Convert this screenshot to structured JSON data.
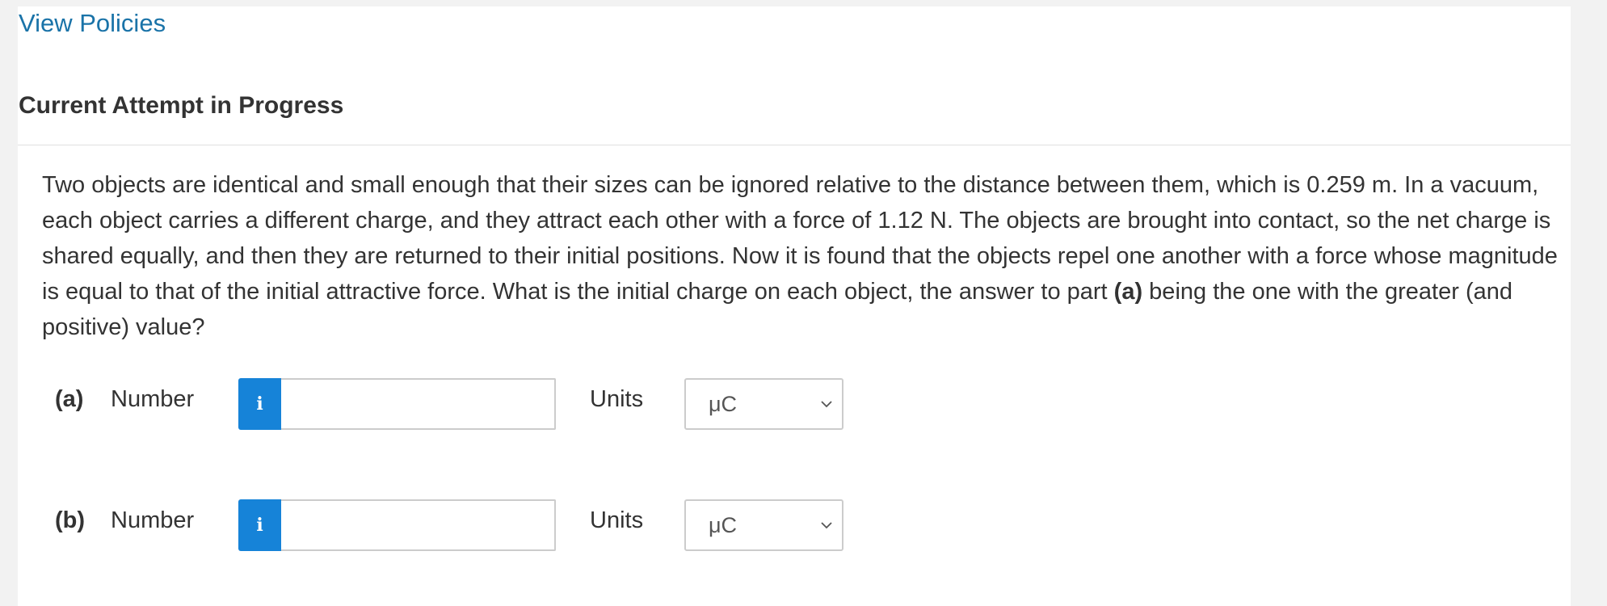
{
  "links": {
    "view_policies": "View Policies"
  },
  "attempt": {
    "heading": "Current Attempt in Progress"
  },
  "question": {
    "text_before": "Two objects are identical and small enough that their sizes can be ignored relative to the distance between them, which is 0.259 m. In a vacuum, each object carries a different charge, and they attract each other with a force of 1.12 N. The objects are brought into contact, so the net charge is shared equally, and then they are returned to their initial positions. Now it is found that the objects repel one another with a force whose magnitude is equal to that of the initial attractive force. What is the initial charge on each object, the answer to part ",
    "bold_part": "(a)",
    "text_after": " being the one with the greater (and positive) value?"
  },
  "answers": [
    {
      "part_label": "(a)",
      "number_label": "Number",
      "info_icon": "info-icon",
      "value": "",
      "units_label": "Units",
      "selected_unit": "μC"
    },
    {
      "part_label": "(b)",
      "number_label": "Number",
      "info_icon": "info-icon",
      "value": "",
      "units_label": "Units",
      "selected_unit": "μC"
    }
  ],
  "colors": {
    "link": "#1a73a8",
    "info_button": "#1683d8",
    "text": "#333333",
    "background": "#f2f2f2"
  }
}
